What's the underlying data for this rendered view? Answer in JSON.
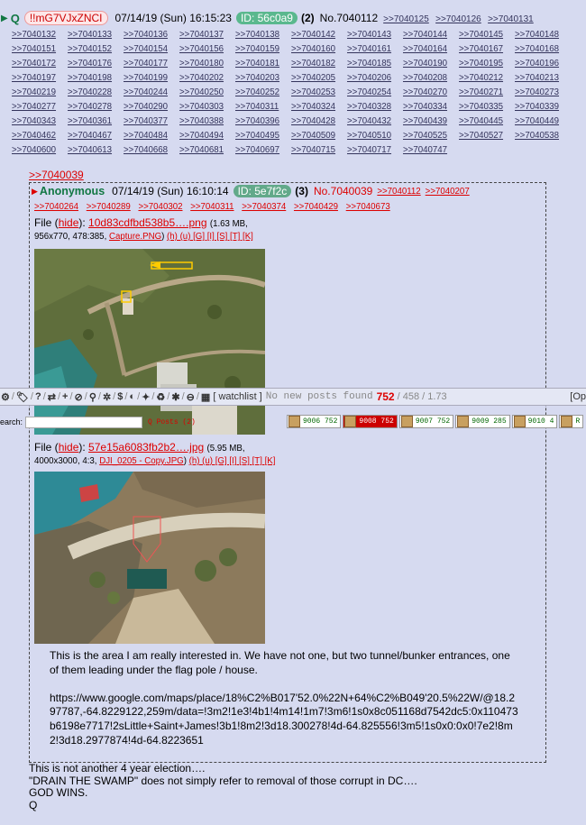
{
  "top_post": {
    "name": "Q",
    "trip": "!!mG7VJxZNCI",
    "date": "07/14/19 (Sun) 16:15:23",
    "id_label": "ID: 56c0a9",
    "id_count": "(2)",
    "post_no": "No.7040112",
    "header_backlinks": [
      ">>7040125",
      ">>7040126",
      ">>7040131"
    ],
    "backlink_rows": [
      [
        ">>7040132",
        ">>7040133",
        ">>7040136",
        ">>7040137",
        ">>7040138",
        ">>7040142",
        ">>7040143",
        ">>7040144",
        ">>7040145",
        ">>7040148"
      ],
      [
        ">>7040151",
        ">>7040152",
        ">>7040154",
        ">>7040156",
        ">>7040159",
        ">>7040160",
        ">>7040161",
        ">>7040164",
        ">>7040167",
        ">>7040168"
      ],
      [
        ">>7040172",
        ">>7040176",
        ">>7040177",
        ">>7040180",
        ">>7040181",
        ">>7040182",
        ">>7040185",
        ">>7040190",
        ">>7040195",
        ">>7040196"
      ],
      [
        ">>7040197",
        ">>7040198",
        ">>7040199",
        ">>7040202",
        ">>7040203",
        ">>7040205",
        ">>7040206",
        ">>7040208",
        ">>7040212",
        ">>7040213"
      ],
      [
        ">>7040219",
        ">>7040228",
        ">>7040244",
        ">>7040250",
        ">>7040252",
        ">>7040253",
        ">>7040254",
        ">>7040270",
        ">>7040271",
        ">>7040273"
      ],
      [
        ">>7040277",
        ">>7040278",
        ">>7040290",
        ">>7040303",
        ">>7040311",
        ">>7040324",
        ">>7040328",
        ">>7040334",
        ">>7040335",
        ">>7040339"
      ],
      [
        ">>7040343",
        ">>7040361",
        ">>7040377",
        ">>7040388",
        ">>7040396",
        ">>7040428",
        ">>7040432",
        ">>7040439",
        ">>7040445",
        ">>7040449"
      ],
      [
        ">>7040462",
        ">>7040467",
        ">>7040484",
        ">>7040494",
        ">>7040495",
        ">>7040509",
        ">>7040510",
        ">>7040525",
        ">>7040527",
        ">>7040538"
      ],
      [
        ">>7040600",
        ">>7040613",
        ">>7040668",
        ">>7040681",
        ">>7040697",
        ">>7040715",
        ">>7040717",
        ">>7040747"
      ]
    ],
    "final_text": [
      "This is not another 4 year election….",
      "\"DRAIN THE SWAMP\" does not simply refer to removal of those corrupt in DC….",
      "GOD WINS.",
      "Q"
    ]
  },
  "reply": {
    "quote_link": ">>7040039",
    "name": "Anonymous",
    "date": "07/14/19 (Sun) 16:10:14",
    "id_label": "ID: 5e7f2c",
    "id_count": "(3)",
    "post_no": "No.7040039",
    "header_backlinks": [
      ">>7040112",
      ">>7040207"
    ],
    "backlinks": [
      ">>7040264",
      ">>7040289",
      ">>7040302",
      ">>7040311",
      ">>7040374",
      ">>7040429",
      ">>7040673"
    ],
    "file1": {
      "label": "File",
      "hide": "hide",
      "filename": "10d83cdfbd538b5….png",
      "size": "(1.63 MB,",
      "meta": "956x770, 478:385,",
      "orig": "Capture.PNG",
      "actions": "(h) (u) [G] [I] [S] [T] [K]"
    },
    "file2": {
      "label": "File",
      "hide": "hide",
      "filename": "57e15a6083fb2b2….jpg",
      "size": "(5.95 MB,",
      "meta": "4000x3000, 4:3,",
      "orig": "DJI_0205 - Copy.JPG",
      "actions": "(h) (u) [G] [I] [S] [T] [K]"
    },
    "body": [
      "This is the area I am really interested in.  We have not one, but two tunnel/bunker entrances, one of them leading under the flag pole / house.",
      "",
      "https://www.google.com/maps/place/18%C2%B017'52.0%22N+64%C2%B049'20.5%22W/@18.297787,-64.8229122,259m/data=!3m2!1e3!4b1!4m14!1m7!3m6!1s0x8c051168d7542dc5:0x110473b6198e7717!2sLittle+Saint+James!3b1!8m2!3d18.300278!4d-64.825556!3m5!1s0x0:0x0!7e2!8m2!3d18.2977874!4d-64.8223651"
    ]
  },
  "toolbar": {
    "watchlist": "[ watchlist ]",
    "no_posts": "No new posts found",
    "count_red": "752",
    "count_rest": "/ 458 / 1.73",
    "right": "[Op"
  },
  "searchbar": {
    "label": "earch:",
    "qposts": "Q Posts (2)",
    "tabs": [
      {
        "label": "9006 752",
        "active": false
      },
      {
        "label": "9008 752",
        "active": true
      },
      {
        "label": "9007 752",
        "active": false
      },
      {
        "label": "9009 285",
        "active": false
      },
      {
        "label": "9010 4",
        "active": false
      },
      {
        "label": "R",
        "active": false
      }
    ]
  },
  "colors": {
    "id_top": "#5ab88e",
    "id_reply": "#62a98a",
    "background": "#d6daf0"
  }
}
